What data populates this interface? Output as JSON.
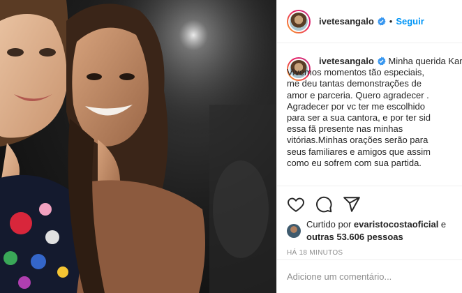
{
  "post": {
    "author": "ivetesangalo",
    "follow_label": "Seguir",
    "separator": "•",
    "caption_lines": [
      "Minha querida Kar",
      "Vivemos momentos tão especiais, ",
      "me deu tantas demonstrações de",
      "amor e parceria. Quero agradecer .",
      "Agradecer por vc ter me escolhido",
      "para ser a sua cantora, e por ter sid",
      "essa fã presente nas minhas",
      "vitórias.Minhas orações serão para",
      "seus familiares e amigos que assim",
      "como eu sofrem com sua partida."
    ],
    "liked_by_prefix": "Curtido por ",
    "liked_by_user": "evaristocostaoficial",
    "liked_by_middle": " e",
    "liked_by_others": "outras 53.606 pessoas",
    "timestamp": "HÁ 18 MINUTOS",
    "comment_placeholder": "Adicione um comentário..."
  },
  "icons": {
    "verified": "verified-badge-icon",
    "like": "heart-icon",
    "comment": "comment-bubble-icon",
    "share": "paper-plane-icon"
  },
  "colors": {
    "accent": "#0095f6",
    "text": "#262626",
    "muted": "#8e8e8e",
    "border": "#efefef"
  }
}
